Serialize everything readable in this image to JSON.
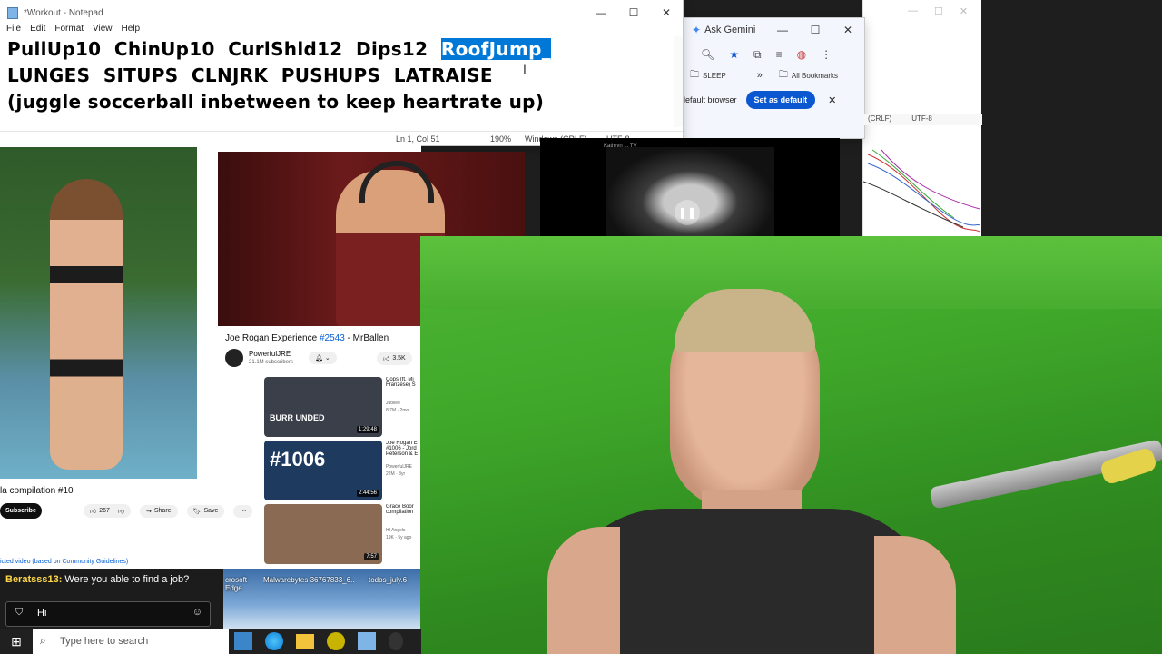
{
  "notepad": {
    "title": "*Workout - Notepad",
    "menu": [
      "File",
      "Edit",
      "Format",
      "View",
      "Help"
    ],
    "line1_plain": "PullUp10  ChinUp10  CurlShld12  Dips12  ",
    "line1_selected": "RoofJump_",
    "line2": "LUNGES  SITUPS  CLNJRK  PUSHUPS  LATRAISE",
    "line3": "(juggle soccerball inbetween to keep heartrate up)",
    "status": {
      "position": "Ln 1, Col 51",
      "zoom": "190%",
      "eol": "Windows (CRLF)",
      "encoding": "UTF-8"
    }
  },
  "chrome": {
    "ask_gemini": "Ask Gemini",
    "bookmark_folder": "SLEEP",
    "more": "»",
    "all_bookmarks": "All Bookmarks",
    "default_prompt": "default browser",
    "set_default": "Set as default",
    "back_status_eol": "(CRLF)",
    "back_status_enc": "UTF-8"
  },
  "video_player": {
    "title_prefix": "Joe Rogan Experience ",
    "episode": "#2543",
    "title_suffix": " - MrBallen",
    "channel": "PowerfulJRE",
    "subscribers": "21.1M subscribers",
    "likes": "3.5K"
  },
  "left_video": {
    "title": "la compilation #10",
    "subscribe": "Subscribe",
    "likes": "267",
    "share": "Share",
    "save": "Save",
    "notice": "icted video (based on Community Guidelines)"
  },
  "recommendations": [
    {
      "title": "Cops (ft. Mi Franzese) S",
      "channel": "Jubilee",
      "meta": "8.7M · 2mo",
      "duration": "1:29:48",
      "thumb_text": "BURR UNDED",
      "color": "#3b3f4a"
    },
    {
      "title": "Joe Rogan E #1006 - Jord Peterson & E",
      "channel": "PowerfulJRE",
      "meta": "22M · 8yr",
      "duration": "2:44:56",
      "thumb_text": "#1006",
      "color": "#1e3a5f"
    },
    {
      "title": "Grace Boor compilation",
      "channel": "HI Angels",
      "meta": "19K · 5y ago",
      "duration": "7:57",
      "thumb_text": "",
      "color": "#8a6a52"
    }
  ],
  "middle_video": {
    "caption": "Kathryn ... TV"
  },
  "chat": {
    "username": "Beratsss13:",
    "message": " Were you able to find a job?",
    "input_value": "Hi"
  },
  "desktop_icons": [
    {
      "label": "crosoft Edge"
    },
    {
      "label": "Malwarebytes 36767833_6..."
    },
    {
      "label": "todos_july.6"
    }
  ],
  "taskbar": {
    "search_placeholder": "Type here to search"
  },
  "colors": {
    "accent": "#0b57d0",
    "selection": "#0078d7",
    "green_bg": "#3fa82a",
    "yt_link": "#065fd4"
  }
}
